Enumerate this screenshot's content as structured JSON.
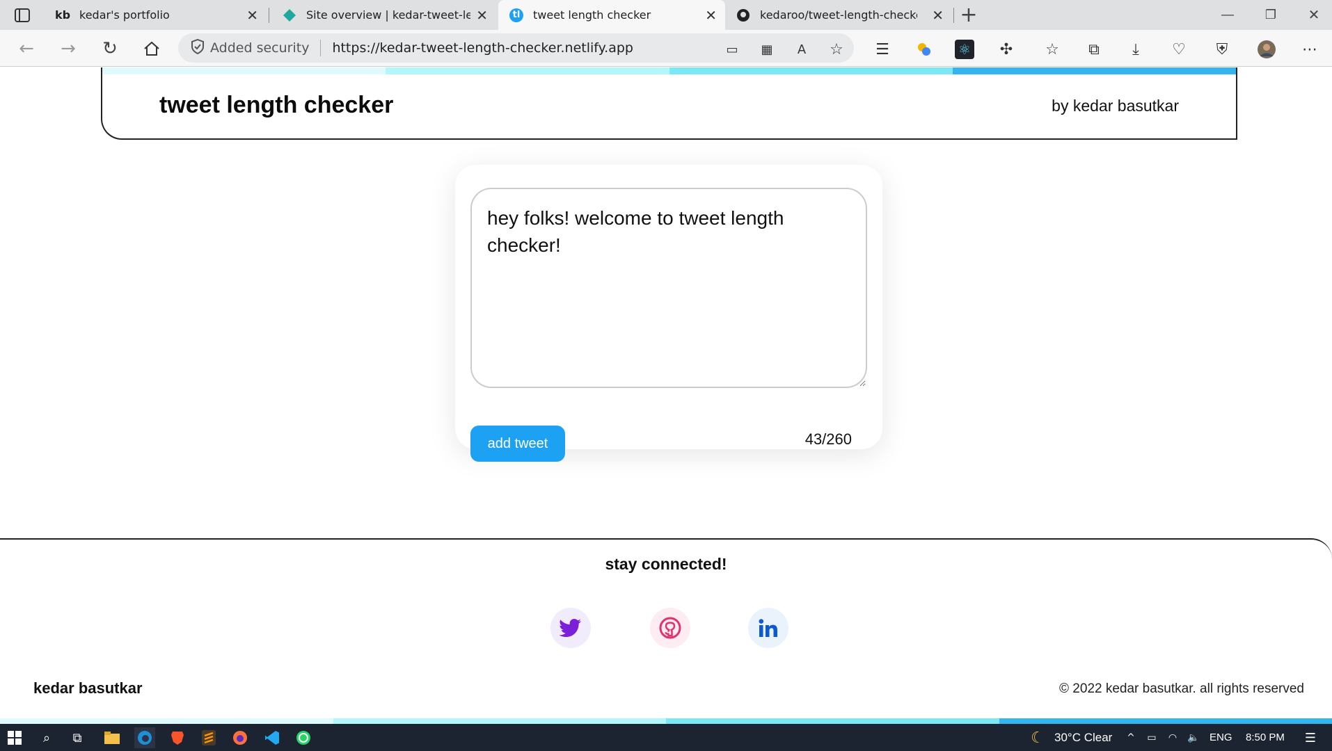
{
  "browser": {
    "tabs": [
      {
        "favicon": "kb",
        "title": "kedar's portfolio",
        "active": false
      },
      {
        "favicon": "netlify-diamond-icon",
        "title": "Site overview | kedar-tweet-leng",
        "active": false
      },
      {
        "favicon": "tl",
        "title": "tweet length checker",
        "active": true
      },
      {
        "favicon": "github-icon",
        "title": "kedaroo/tweet-length-checker: c",
        "active": false
      }
    ],
    "new_tab_label": "+",
    "security_label": "Added security",
    "url": "https://kedar-tweet-length-checker.netlify.app"
  },
  "header": {
    "title": "tweet length checker",
    "byline": "by kedar basutkar"
  },
  "composer": {
    "tweet_text": "hey folks! welcome to tweet length checker!",
    "button_label": "add tweet",
    "char_count": "43/260"
  },
  "footer": {
    "heading": "stay connected!",
    "socials": [
      "twitter-icon",
      "github-icon",
      "linkedin-icon"
    ],
    "name": "kedar basutkar",
    "copyright": "© 2022 kedar basutkar. all rights reserved"
  },
  "colors": {
    "accent": "#1da1f2",
    "stripe": [
      "#e0fbfd",
      "#b4f7fb",
      "#7ce8f7",
      "#36b4ef"
    ]
  },
  "taskbar": {
    "weather": "30°C Clear",
    "language": "ENG",
    "time": "8:50 PM"
  }
}
